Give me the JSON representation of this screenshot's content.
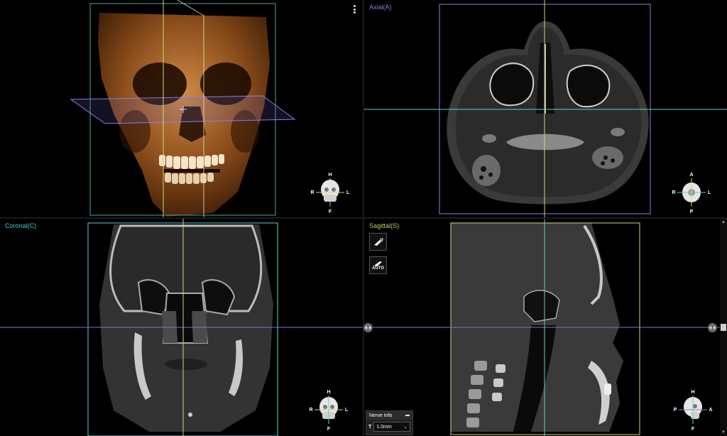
{
  "views": {
    "axial": {
      "label": "Axial(A)",
      "color": "#8a7fe0"
    },
    "coronal": {
      "label": "Coronal(C)",
      "color": "#49c7c7"
    },
    "sagittal": {
      "label": "Sagittal(S)",
      "color": "#c8c85a"
    }
  },
  "orientation": {
    "volume": {
      "top": "H",
      "bottom": "F",
      "left": "R",
      "right": "L"
    },
    "axial": {
      "top": "A",
      "bottom": "P",
      "left": "R",
      "right": "L"
    },
    "coronal": {
      "top": "H",
      "bottom": "F",
      "left": "R",
      "right": "L"
    },
    "sagittal": {
      "top": "H",
      "bottom": "F",
      "left": "P",
      "right": "A"
    }
  },
  "tools": {
    "auto_label": "AUTO"
  },
  "nerve_info": {
    "title": "Nerve Info",
    "thickness_label": "T",
    "thickness_value": "1.0mm"
  },
  "colors": {
    "axial_line": "#7d74d8",
    "coronal_line": "#5bd0d0",
    "sagittal_line": "#d6d66a"
  }
}
